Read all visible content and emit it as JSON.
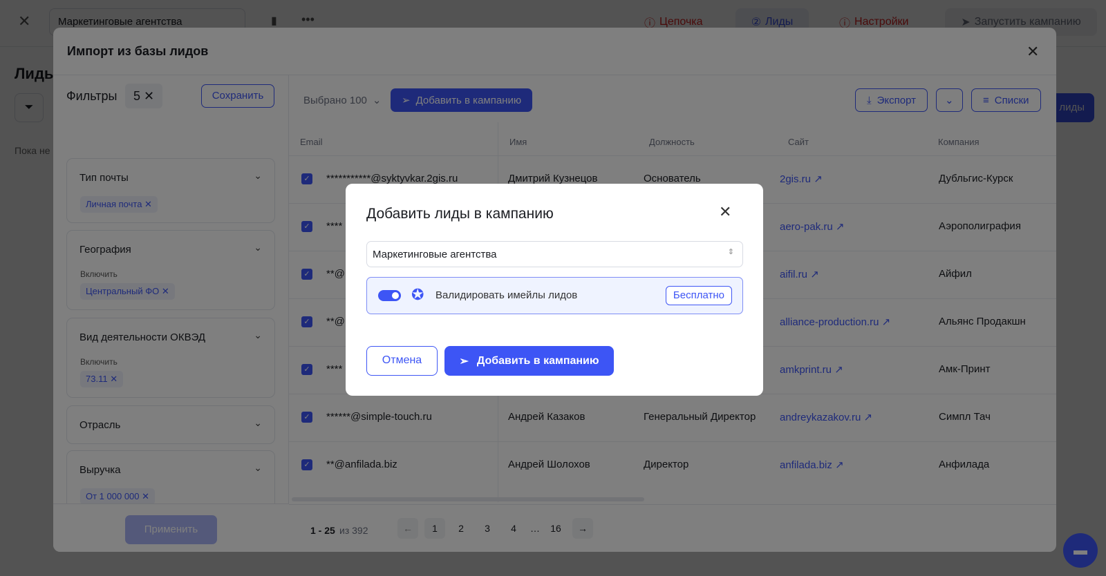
{
  "topbar": {
    "campaign_name": "Маркетинговые агентства",
    "tabs": [
      {
        "label": "Цепочка",
        "icon": "alert-circle-icon"
      },
      {
        "label": "Лиды",
        "icon": "step-2-icon"
      },
      {
        "label": "Настройки",
        "icon": "alert-circle-icon"
      }
    ],
    "launch": "Запустить кампанию"
  },
  "page": {
    "title": "Лиды",
    "empty": "Пока не",
    "add_leads": "лиды"
  },
  "import_modal": {
    "title": "Импорт из базы лидов",
    "filters": {
      "label": "Фильтры",
      "count": "5",
      "save": "Сохранить",
      "apply": "Применить",
      "groups": [
        {
          "title": "Тип почты",
          "chips": [
            "Личная почта"
          ]
        },
        {
          "title": "География",
          "include": "Включить",
          "chips": [
            "Центральный ФО"
          ]
        },
        {
          "title": "Вид деятельности ОКВЭД",
          "include": "Включить",
          "chips": [
            "73.11"
          ]
        },
        {
          "title": "Отрасль"
        },
        {
          "title": "Выручка",
          "chips": [
            "От 1 000 000"
          ]
        }
      ]
    },
    "toolbar": {
      "selected": "Выбрано 100",
      "add": "Добавить в кампанию",
      "export": "Экспорт",
      "lists": "Списки"
    },
    "columns": [
      "Email",
      "Имя",
      "Должность",
      "Сайт",
      "Компания"
    ],
    "rows": [
      {
        "email": "***********@syktyvkar.2gis.ru",
        "name": "Дмитрий Кузнецов",
        "position": "Основатель",
        "site": "2gis.ru",
        "company": "Дубльгис-Курск"
      },
      {
        "email": "****",
        "site": "aero-pak.ru",
        "company": "Аэрополиграфия"
      },
      {
        "email": "**@",
        "site": "aifil.ru",
        "company": "Айфил"
      },
      {
        "email": "**@",
        "site": "alliance-production.ru",
        "company": "Альянс Продакшн"
      },
      {
        "email": "****",
        "site": "amkprint.ru",
        "company": "Амк-Принт"
      },
      {
        "email": "******@simple-touch.ru",
        "name": "Андрей Казаков",
        "position": "Генеральный Директор",
        "site": "andreykazakov.ru",
        "company": "Симпл Тач"
      },
      {
        "email": "**@anfilada.biz",
        "name": "Андрей Шолохов",
        "position": "Директор",
        "site": "anfilada.biz",
        "company": "Анфилада"
      }
    ],
    "pagination": {
      "range": "1 - 25",
      "of": "из 392",
      "pages": [
        "1",
        "2",
        "3",
        "4",
        "…",
        "16"
      ]
    }
  },
  "dialog": {
    "title": "Добавить лиды в кампанию",
    "campaign": "Маркетинговые агентства",
    "validate": "Валидировать имейлы лидов",
    "validate_on": true,
    "free": "Бесплатно",
    "cancel": "Отмена",
    "add": "Добавить в кампанию"
  },
  "colors": {
    "primary": "#3d55f5",
    "error": "#e02424"
  }
}
